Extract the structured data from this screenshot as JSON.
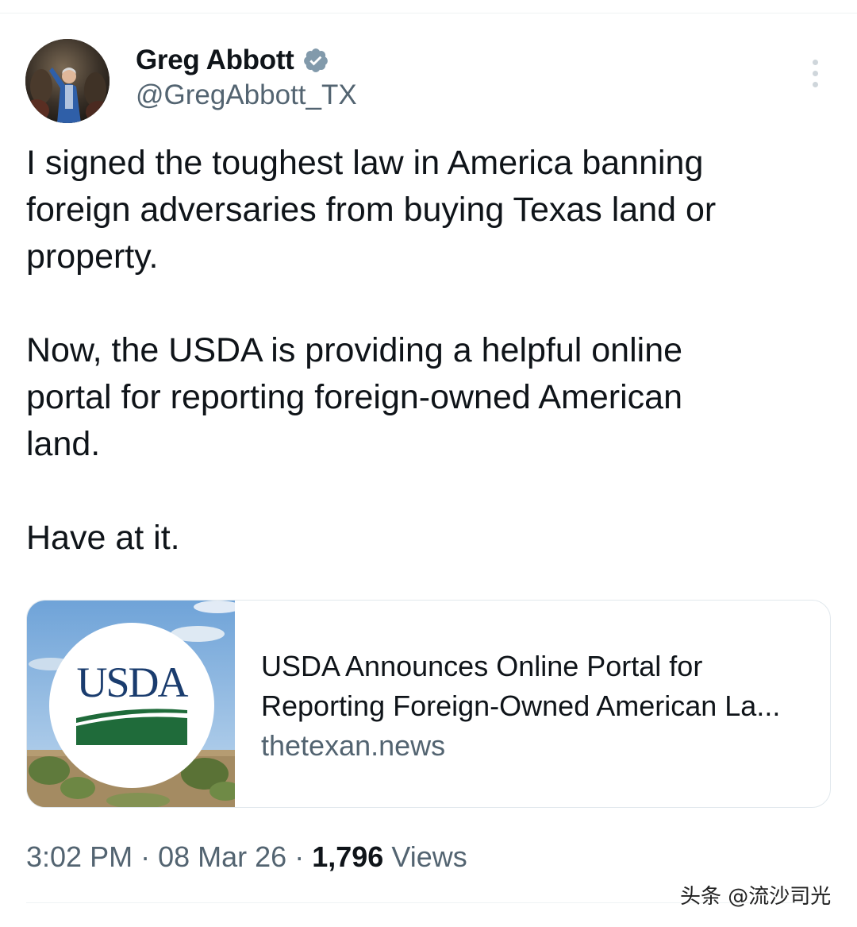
{
  "author": {
    "display_name": "Greg Abbott",
    "handle": "@GregAbbott_TX",
    "verified": true
  },
  "tweet": {
    "paragraphs": [
      "I signed the toughest law in America banning\nforeign adversaries from buying Texas land or\nproperty.",
      "Now, the USDA is providing a helpful online\nportal for reporting foreign-owned American\nland.",
      "Have at it."
    ]
  },
  "card": {
    "logo_text": "USDA",
    "title_line1": "USDA Announces Online Portal for",
    "title_line2": "Reporting Foreign-Owned American La...",
    "domain": "thetexan.news"
  },
  "meta": {
    "time": "3:02 PM",
    "separator": "·",
    "date": "08 Mar 26",
    "views_count": "1,796",
    "views_label": "Views"
  },
  "watermark": "头条 @流沙司光",
  "colors": {
    "text_primary": "#0f1419",
    "text_secondary": "#536471",
    "verified_badge": "#829aab",
    "usda_blue": "#1a3c6e",
    "usda_green": "#1f6b3a"
  }
}
